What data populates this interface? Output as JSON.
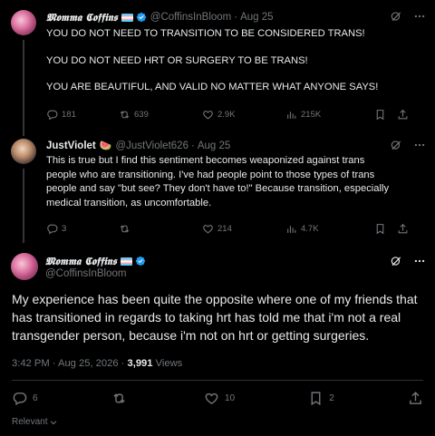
{
  "tweet1": {
    "display_name": "𝕸𝖔𝖒𝖒𝖆 𝕮𝖔𝖋𝖋𝖎𝖓𝖘",
    "handle": "@CoffinsInBloom",
    "date": "Aug 25",
    "paragraphs": [
      "YOU DO NOT NEED TO TRANSITION TO BE CONSIDERED TRANS!",
      "YOU DO NOT NEED HRT OR SURGERY TO BE TRANS!",
      "YOU ARE BEAUTIFUL, AND VALID NO MATTER WHAT ANYONE SAYS!"
    ],
    "replies": "181",
    "reposts": "639",
    "likes": "2.9K",
    "views": "215K"
  },
  "tweet2": {
    "display_name": "JustViolet",
    "emoji": "🍉",
    "handle": "@JustViolet626",
    "date": "Aug 25",
    "text": "This is true but I find this sentiment becomes weaponized against trans people who are transitioning. I've had people point to those types of trans people and say \"but see? They don't have to!\" Because transition, especially medical transition, as uncomfortable.",
    "replies": "3",
    "reposts": "",
    "likes": "214",
    "views": "4.7K"
  },
  "main": {
    "display_name": "𝕸𝖔𝖒𝖒𝖆 𝕮𝖔𝖋𝖋𝖎𝖓𝖘",
    "handle": "@CoffinsInBloom",
    "text": "My experience has been quite the opposite where one of my friends that has transitioned in regards to taking hrt has told me that i'm not a real transgender person, because i'm not on hrt or getting surgeries.",
    "time": "3:42 PM · Aug 25, 2026 · ",
    "views_count": "3,991",
    "views_label": " Views",
    "replies": "6",
    "reposts": "",
    "likes": "10",
    "bookmarks": "2",
    "sort_label": "Relevant"
  },
  "colors": {
    "background": "#000000",
    "text": "#e7e9ea",
    "muted": "#71767b",
    "verified": "#1d9bf0",
    "divider": "#2f3336"
  },
  "icons": [
    "reply-icon",
    "repost-icon",
    "like-icon",
    "views-icon",
    "bookmark-icon",
    "share-icon",
    "grok-icon",
    "more-icon",
    "verified-icon",
    "trans-flag-icon",
    "chevron-down-icon"
  ]
}
